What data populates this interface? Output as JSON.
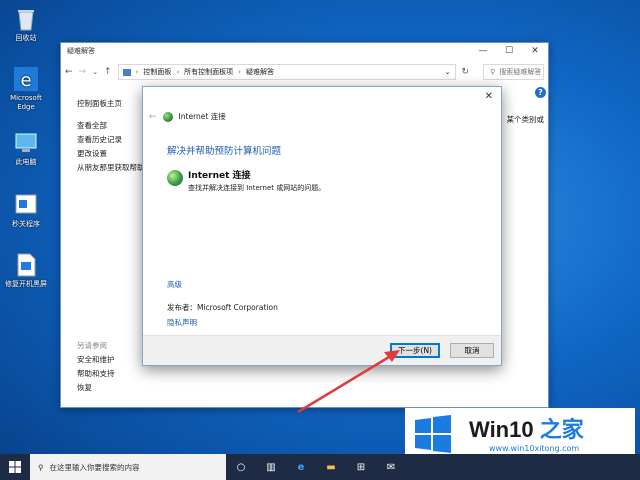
{
  "desktop": {
    "icons": [
      {
        "label": "回收站",
        "icon": "recycle-bin-icon"
      },
      {
        "label": "Microsoft Edge",
        "icon": "edge-icon"
      },
      {
        "label": "此电脑",
        "icon": "this-pc-icon"
      },
      {
        "label": "秒关程序",
        "icon": "program-icon"
      },
      {
        "label": "修复开机黑屏",
        "icon": "repair-icon"
      }
    ]
  },
  "explorer": {
    "title": "疑难解答",
    "controls": {
      "minimize": "—",
      "maximize": "☐",
      "close": "✕"
    },
    "breadcrumb": [
      "控制面板",
      "所有控制面板项",
      "疑难解答"
    ],
    "search_placeholder": "搜索疑难解答",
    "left_links": [
      "控制面板主页",
      "查看全部",
      "查看历史记录",
      "更改设置",
      "从朋友那里获取帮助"
    ],
    "see_also": {
      "heading": "另请参阅",
      "links": [
        "安全和维护",
        "帮助和支持",
        "恢复"
      ]
    },
    "right_partial_text": "某个类别或"
  },
  "dialog": {
    "header": "Internet 连接",
    "heading": "解决并帮助预防计算机问题",
    "item_title": "Internet 连接",
    "item_desc": "查找并解决连接到 Internet 或网站的问题。",
    "advanced": "高级",
    "publisher": "发布者：Microsoft Corporation",
    "privacy": "隐私声明",
    "next_button": "下一步(N)",
    "cancel_button": "取消"
  },
  "badge": {
    "brand_a": "Win10 ",
    "brand_b": "之家",
    "url": "www.win10xitong.com"
  },
  "taskbar": {
    "search_placeholder": "在这里输入你要搜索的内容"
  },
  "colors": {
    "accent": "#1a5fb4",
    "badge_blue": "#1a7be0",
    "arrow": "#e03a3a",
    "taskbar": "#1d2b44"
  }
}
